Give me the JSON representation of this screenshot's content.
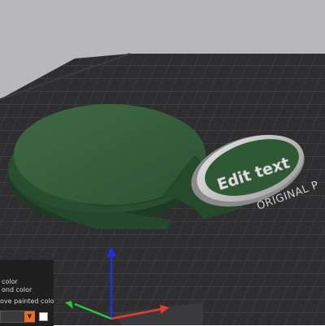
{
  "viewport": {
    "bed_label": "ORIGINAL P",
    "model_text": "Edit text"
  },
  "paint_panel": {
    "rows": [
      "color",
      "ond color",
      "ove painted color"
    ],
    "color_dropdown": {
      "selected_color": "#ed6b21"
    },
    "swatch_color": "#ffffff"
  },
  "colors": {
    "background": "#b8b8bc",
    "bed_surface": "#2e2e30",
    "model_green": "#365e3a",
    "accent_orange": "#ed6b21",
    "axis_x": "#e83a2e",
    "axis_y": "#2cc33a",
    "axis_z": "#2030e0"
  },
  "icons": {
    "axes": "xyz-axes-icon",
    "dropdown": "dropdown-arrow-icon"
  }
}
